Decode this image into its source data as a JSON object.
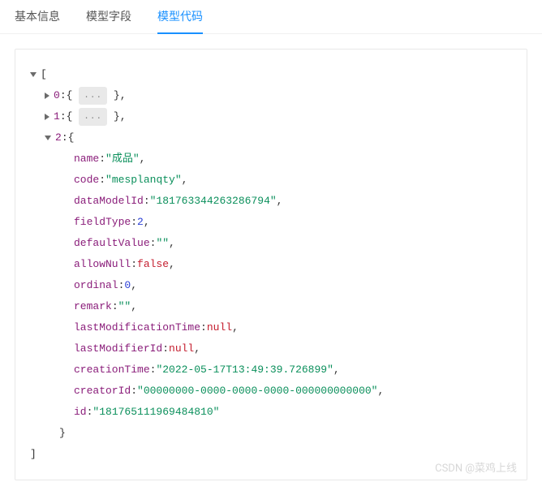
{
  "tabs": [
    {
      "label": "基本信息",
      "active": false
    },
    {
      "label": "模型字段",
      "active": false
    },
    {
      "label": "模型代码",
      "active": true
    }
  ],
  "ellipsis": "...",
  "tree": {
    "root_open": "[",
    "root_close": "]",
    "collapsed": [
      {
        "index": "0",
        "open": "{",
        "close": "}"
      },
      {
        "index": "1",
        "open": "{",
        "close": "}"
      }
    ],
    "expanded": {
      "index": "2",
      "open": "{",
      "close": "}",
      "props": [
        {
          "key": "name",
          "type": "str",
          "value": "\"成品\"",
          "comma": ","
        },
        {
          "key": "code",
          "type": "str",
          "value": "\"mesplanqty\"",
          "comma": ","
        },
        {
          "key": "dataModelId",
          "type": "str",
          "value": "\"181763344263286794\"",
          "comma": ","
        },
        {
          "key": "fieldType",
          "type": "num",
          "value": "2",
          "comma": ","
        },
        {
          "key": "defaultValue",
          "type": "str",
          "value": "\"\"",
          "comma": ","
        },
        {
          "key": "allowNull",
          "type": "lit",
          "value": "false",
          "comma": ","
        },
        {
          "key": "ordinal",
          "type": "num",
          "value": "0",
          "comma": ","
        },
        {
          "key": "remark",
          "type": "str",
          "value": "\"\"",
          "comma": ","
        },
        {
          "key": "lastModificationTime",
          "type": "lit",
          "value": "null",
          "comma": ","
        },
        {
          "key": "lastModifierId",
          "type": "lit",
          "value": "null",
          "comma": ","
        },
        {
          "key": "creationTime",
          "type": "str",
          "value": "\"2022-05-17T13:49:39.726899\"",
          "comma": ","
        },
        {
          "key": "creatorId",
          "type": "str",
          "value": "\"00000000-0000-0000-0000-000000000000\"",
          "comma": ","
        },
        {
          "key": "id",
          "type": "str",
          "value": "\"181765111969484810\"",
          "comma": ""
        }
      ]
    }
  },
  "watermark": "CSDN @菜鸡上线"
}
